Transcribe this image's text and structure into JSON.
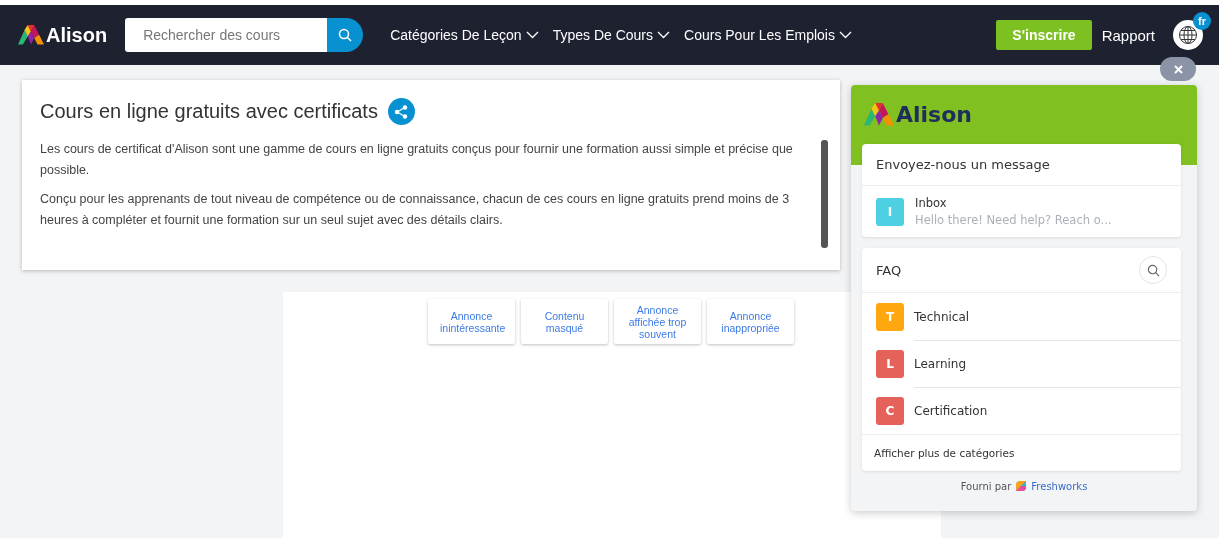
{
  "nav": {
    "logo": "Alison",
    "search": {
      "placeholder": "Rechercher des cours"
    },
    "menus": [
      "Catégories De Leçon",
      "Types De Cours",
      "Cours Pour Les Emplois"
    ],
    "signup": "S'inscrire",
    "report": "Rapport",
    "language_badge": "fr"
  },
  "intro": {
    "title": "Cours en ligne gratuits avec certificats",
    "paragraphs": [
      "Les cours de certificat d'Alison sont une gamme de cours en ligne gratuits conçus pour fournir une formation aussi simple et précise que possible.",
      "Conçu pour les apprenants de tout niveau de compétence ou de connaissance, chacun de ces cours en ligne gratuits prend moins de 3 heures à compléter et fournit une formation sur un seul sujet avec des détails clairs."
    ]
  },
  "ad_feedback": [
    "Annonce inintéressante",
    "Contenu masqué",
    "Annonce affichée trop souvent",
    "Annonce inappropriée"
  ],
  "widget": {
    "logo": "Alison",
    "message_title": "Envoyez-nous un message",
    "inbox": {
      "letter": "I",
      "title": "Inbox",
      "preview": "Hello there! Need help? Reach o...",
      "color": "#4dd0e1"
    },
    "faq_title": "FAQ",
    "faq": [
      {
        "letter": "T",
        "label": "Technical",
        "color": "#ffa70f"
      },
      {
        "letter": "L",
        "label": "Learning",
        "color": "#e5625a"
      },
      {
        "letter": "C",
        "label": "Certification",
        "color": "#e5625a"
      }
    ],
    "more": "Afficher plus de catégories",
    "powered_by": "Fourni par",
    "brand": "Freshworks"
  }
}
